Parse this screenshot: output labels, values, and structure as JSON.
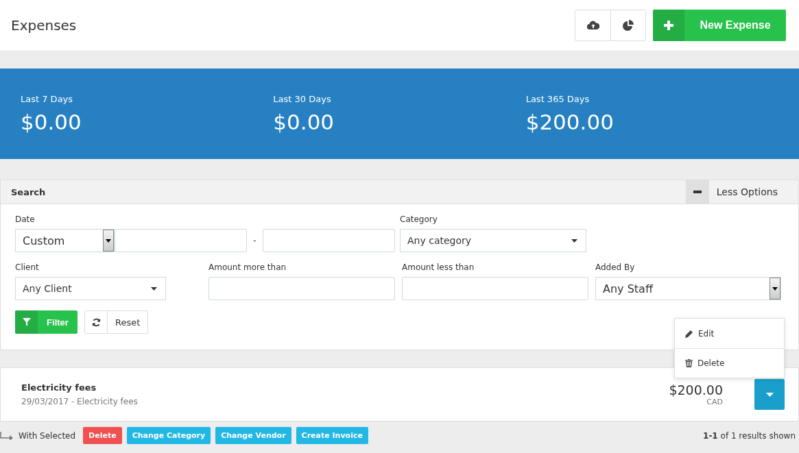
{
  "header": {
    "title": "Expenses",
    "new_button": "New Expense"
  },
  "stats": [
    {
      "label": "Last 7 Days",
      "value": "$0.00"
    },
    {
      "label": "Last 30 Days",
      "value": "$0.00"
    },
    {
      "label": "Last 365 Days",
      "value": "$200.00"
    }
  ],
  "search": {
    "title": "Search",
    "toggle": "Less Options",
    "date": {
      "label": "Date",
      "value": "Custom",
      "separator": "-"
    },
    "category": {
      "label": "Category",
      "value": "Any category"
    },
    "client": {
      "label": "Client",
      "value": "Any Client"
    },
    "amount_more": {
      "label": "Amount more than"
    },
    "amount_less": {
      "label": "Amount less than"
    },
    "added_by": {
      "label": "Added By",
      "value": "Any Staff"
    },
    "filter_button": "Filter",
    "reset_button": "Reset"
  },
  "menu": [
    {
      "kind": "edit",
      "label": "Edit"
    },
    {
      "kind": "delete",
      "label": "Delete"
    }
  ],
  "expense": {
    "title": "Electricity fees",
    "subtitle": "29/03/2017 - Electricity fees",
    "amount": "$200.00",
    "currency": "CAD"
  },
  "bulk": {
    "label": "With Selected",
    "actions": [
      {
        "label": "Delete",
        "kind": "danger"
      },
      {
        "label": "Change Category",
        "kind": "info"
      },
      {
        "label": "Change Vendor",
        "kind": "info"
      },
      {
        "label": "Create Invoice",
        "kind": "info"
      }
    ]
  },
  "results": "**1-1** of 1 results shown"
}
